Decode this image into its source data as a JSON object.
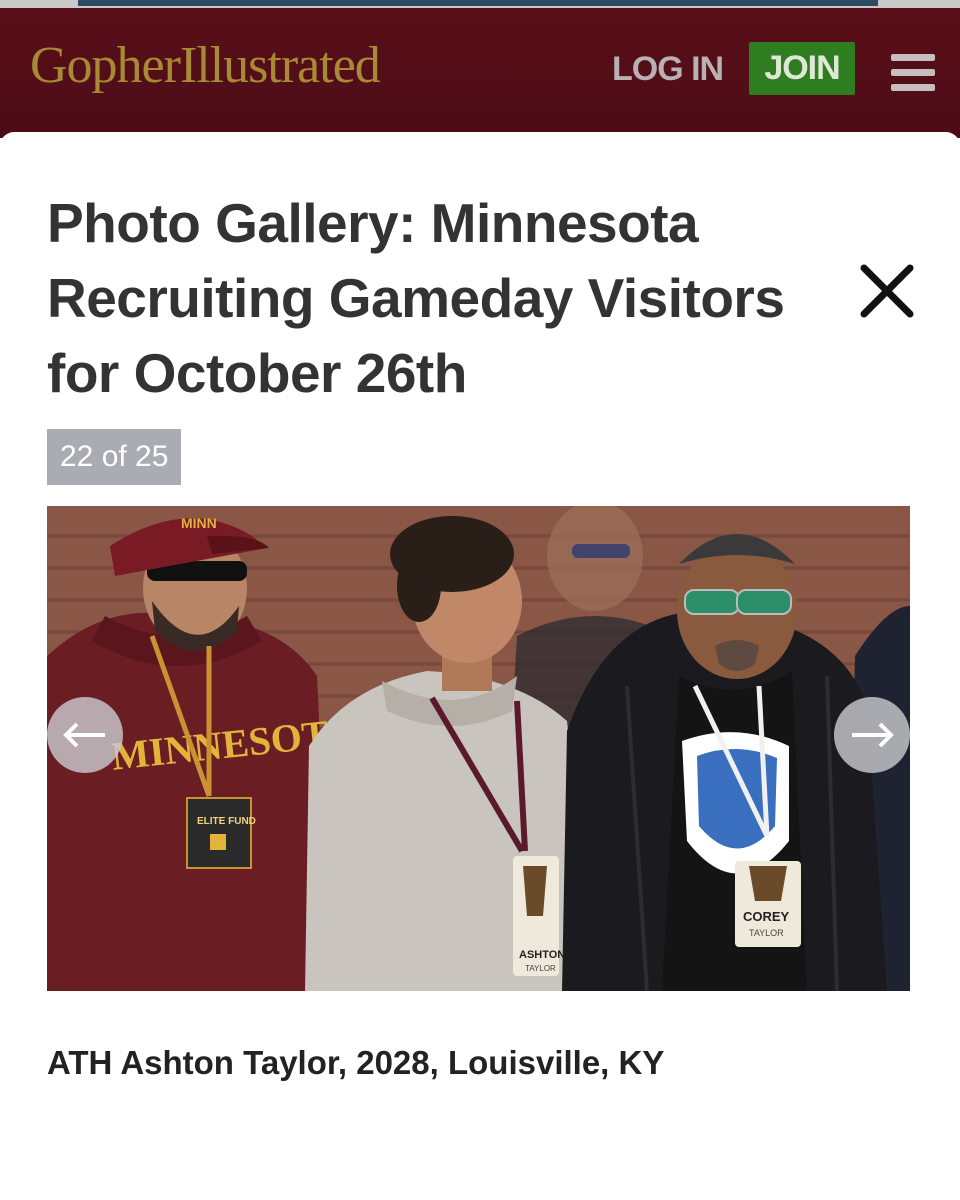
{
  "header": {
    "logo_text": "GopherIllustrated",
    "login_label": "LOG IN",
    "join_label": "JOIN",
    "menu_icon": "hamburger-menu-icon",
    "colors": {
      "bar": "#5a0f1a",
      "logo": "#a88a34",
      "join": "#2e7d1e"
    }
  },
  "gallery": {
    "title": "Photo Gallery: Minnesota Recruiting Gameday Visitors for October 26th",
    "close_icon": "close-icon",
    "counter": "22 of 25",
    "prev_icon": "arrow-left-icon",
    "next_icon": "arrow-right-icon",
    "caption": "ATH Ashton Taylor, 2028, Louisville, KY",
    "photo": {
      "hoodie_text": "MINNESOTA",
      "cap_text": "MINN",
      "badge_left": "ELITE FUND",
      "badge_middle": "ASHTON",
      "badge_middle_sub": "TAYLOR",
      "badge_right": "COREY",
      "badge_right_sub": "TAYLOR"
    }
  }
}
